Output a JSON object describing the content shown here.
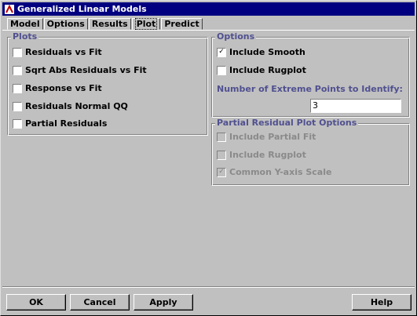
{
  "window": {
    "title": "Generalized Linear Models"
  },
  "tabs": [
    "Model",
    "Options",
    "Results",
    "Plot",
    "Predict"
  ],
  "plots": {
    "legend": "Plots",
    "items": [
      "Residuals vs Fit",
      "Sqrt Abs Residuals vs Fit",
      "Response vs Fit",
      "Residuals Normal QQ",
      "Partial Residuals"
    ]
  },
  "options": {
    "legend": "Options",
    "include_smooth": "Include Smooth",
    "include_rugplot": "Include Rugplot",
    "extreme_label": "Number of Extreme Points to Identify:",
    "extreme_value": "3"
  },
  "partial": {
    "legend": "Partial Residual Plot Options",
    "include_partial_fit": "Include Partial Fit",
    "include_rugplot": "Include Rugplot",
    "common_y": "Common Y-axis Scale"
  },
  "buttons": {
    "ok": "OK",
    "cancel": "Cancel",
    "apply": "Apply",
    "help": "Help"
  }
}
